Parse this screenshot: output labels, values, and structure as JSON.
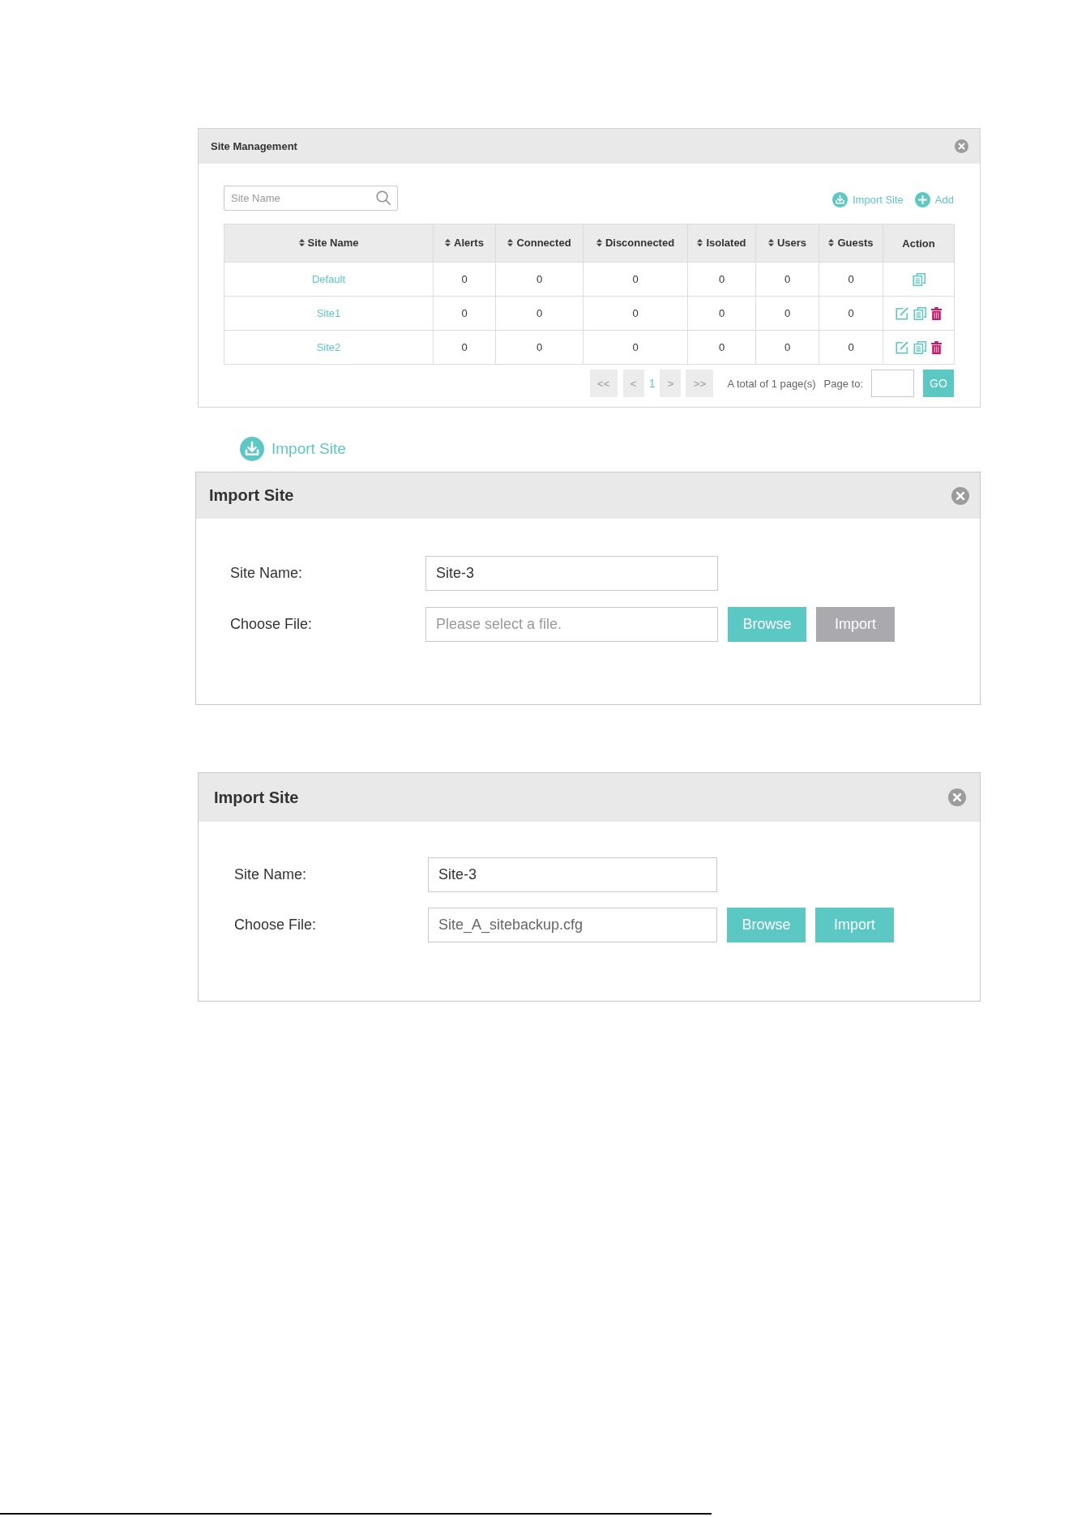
{
  "site_management": {
    "title": "Site Management",
    "search": {
      "placeholder": "Site Name"
    },
    "actions": [
      {
        "kind": "import",
        "label": "Import Site"
      },
      {
        "kind": "add",
        "label": "Add"
      }
    ],
    "table": {
      "columns": [
        {
          "label": "Site Name",
          "sortable": true
        },
        {
          "label": "Alerts",
          "sortable": true
        },
        {
          "label": "Connected",
          "sortable": true
        },
        {
          "label": "Disconnected",
          "sortable": true
        },
        {
          "label": "Isolated",
          "sortable": true
        },
        {
          "label": "Users",
          "sortable": true
        },
        {
          "label": "Guests",
          "sortable": true
        },
        {
          "label": "Action",
          "sortable": false
        }
      ],
      "rows": [
        {
          "cells": [
            "Default",
            "0",
            "0",
            "0",
            "0",
            "0",
            "0"
          ],
          "can_edit": false,
          "can_copy": true,
          "can_delete": false
        },
        {
          "cells": [
            "Site1",
            "0",
            "0",
            "0",
            "0",
            "0",
            "0"
          ],
          "can_edit": true,
          "can_copy": true,
          "can_delete": true
        },
        {
          "cells": [
            "Site2",
            "0",
            "0",
            "0",
            "0",
            "0",
            "0"
          ],
          "can_edit": true,
          "can_copy": true,
          "can_delete": true
        }
      ]
    },
    "pagination": {
      "first": "<<",
      "previous": "<",
      "pages": [
        {
          "label": "1",
          "selected": true
        }
      ],
      "next": ">",
      "last": ">>",
      "total": "A total of 1 page(s)",
      "page_to_label": "Page to:",
      "go": "GO"
    }
  },
  "import_link": {
    "label": "Import Site"
  },
  "dialogs": [
    {
      "title": "Import Site",
      "fields": [
        {
          "kind": "text",
          "label": "Site Name:",
          "value": "Site-3"
        },
        {
          "kind": "file",
          "label": "Choose File:",
          "placeholder": "Please select a file.",
          "buttons": [
            {
              "label": "Browse",
              "disabled": false
            },
            {
              "label": "Import",
              "disabled": true
            }
          ]
        }
      ]
    },
    {
      "title": "Import Site",
      "fields": [
        {
          "kind": "text",
          "label": "Site Name:",
          "value": "Site-3"
        },
        {
          "kind": "file",
          "label": "Choose File:",
          "value": "Site_A_sitebackup.cfg",
          "buttons": [
            {
              "label": "Browse",
              "disabled": false
            },
            {
              "label": "Import",
              "disabled": false
            }
          ]
        }
      ]
    }
  ]
}
